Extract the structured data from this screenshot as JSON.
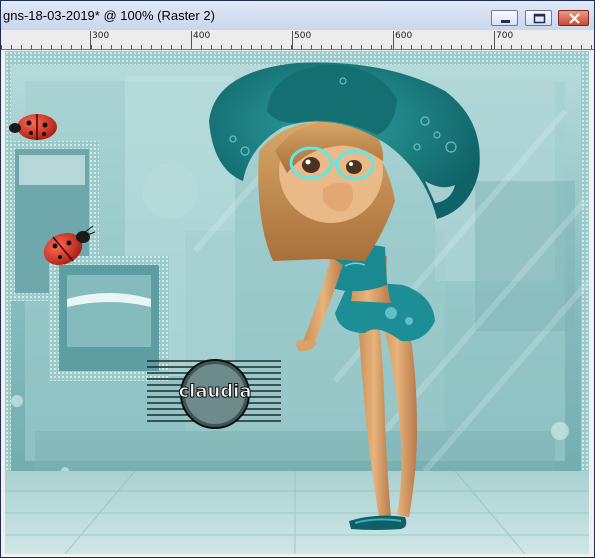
{
  "window": {
    "title": "gns-18-03-2019* @ 100% (Raster 2)",
    "minimize_icon": "minimize-icon",
    "maximize_icon": "maximize-icon",
    "close_icon": "close-icon"
  },
  "ruler": {
    "labels": [
      "300",
      "400",
      "500",
      "600",
      "700"
    ]
  },
  "canvas": {
    "layer": "Raster 2",
    "zoom": "100%",
    "watermark_text": "claudia",
    "colors": {
      "background_teal": "#8fc3c4",
      "hat_teal": "#1f8588",
      "ladybug_red": "#c8281c"
    }
  }
}
